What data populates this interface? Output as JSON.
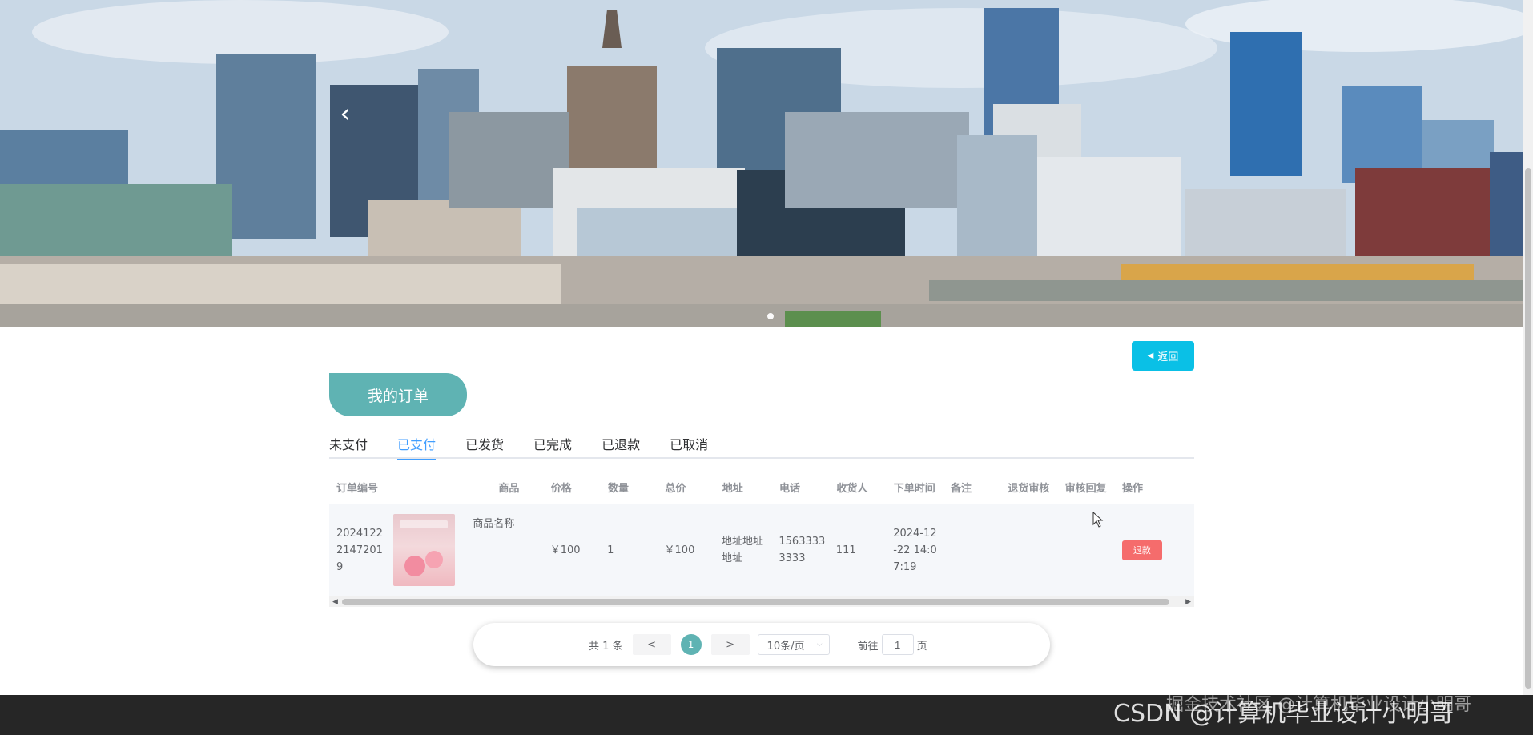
{
  "banner": {
    "prev_icon": "chevron-left-icon",
    "dots": 1
  },
  "header": {
    "back_label": "返回",
    "back_icon": "caret-left-icon"
  },
  "page": {
    "title": "我的订单"
  },
  "tabs": [
    {
      "label": "未支付",
      "active": false
    },
    {
      "label": "已支付",
      "active": true
    },
    {
      "label": "已发货",
      "active": false
    },
    {
      "label": "已完成",
      "active": false
    },
    {
      "label": "已退款",
      "active": false
    },
    {
      "label": "已取消",
      "active": false
    }
  ],
  "table": {
    "columns": [
      "订单编号",
      "商品",
      "价格",
      "数量",
      "总价",
      "地址",
      "电话",
      "收货人",
      "下单时间",
      "备注",
      "退货审核",
      "审核回复",
      "操作"
    ],
    "rows": [
      {
        "order_no": "20241222147201\n9",
        "order_no_lines": [
          "2024122",
          "2147201",
          "9"
        ],
        "goods_name": "商品名称",
        "price": "￥100",
        "qty": "1",
        "total": "￥100",
        "addr_lines": [
          "地址地址",
          "地址"
        ],
        "phone_lines": [
          "1563333",
          "3333"
        ],
        "receiver": "111",
        "time_lines": [
          "2024-12",
          "-22 14:0",
          "7:19"
        ],
        "note": "",
        "return_review": "",
        "review_reply": "",
        "action_label": "退款"
      }
    ]
  },
  "pagination": {
    "total_text": "共 1 条",
    "prev": "<",
    "current": "1",
    "next": ">",
    "page_size": "10条/页",
    "goto_label": "前往",
    "goto_value": "1",
    "page_unit": "页"
  },
  "watermark": {
    "main": "CSDN @计算机毕业设计小明哥",
    "sub": "掘金技术社区 @计算机毕业设计小明哥"
  },
  "colors": {
    "accent": "#5fb3b3",
    "tab_active": "#409eff",
    "back": "#0ac0e6",
    "danger": "#f56c6c",
    "footer": "#262626"
  }
}
